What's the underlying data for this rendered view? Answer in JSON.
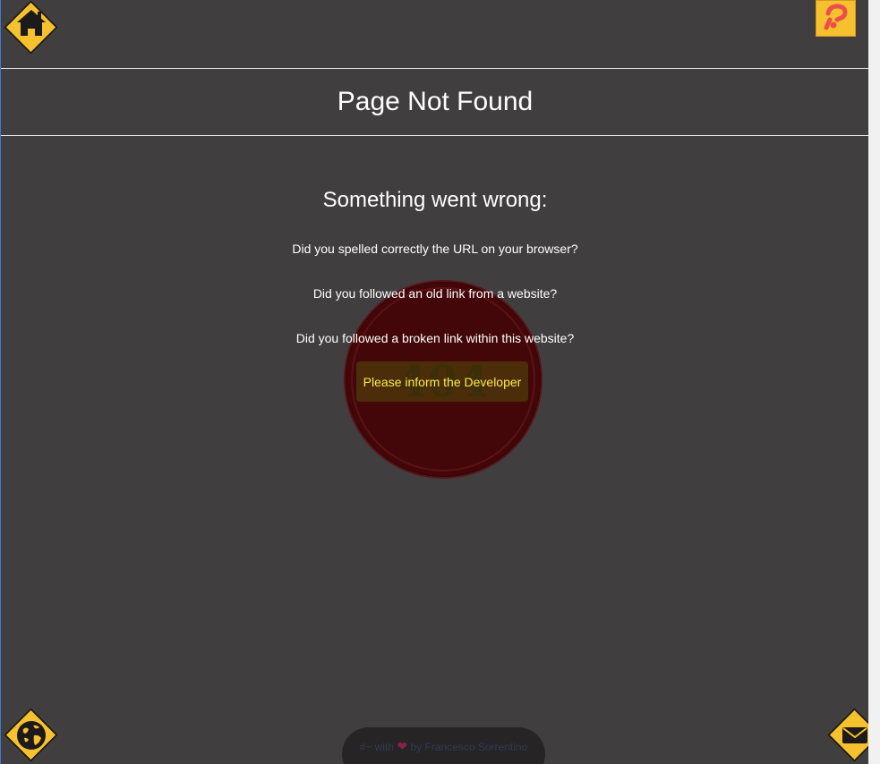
{
  "header": {
    "title": "Page Not Found"
  },
  "badge": {
    "code": "404"
  },
  "main": {
    "subtitle": "Something went wrong:",
    "questions": [
      "Did you spelled correctly the URL on your browser?",
      "Did you followed an old link from a website?",
      "Did you followed a broken link within this website?"
    ],
    "inform_label": "Please inform the Developer"
  },
  "footer": {
    "prefix": "#~ with",
    "suffix": "by Francesco Sorrentino"
  },
  "icons": {
    "home": "home-icon",
    "help": "help-icon",
    "globe": "globe-icon",
    "mail": "mail-icon"
  },
  "colors": {
    "background": "#403e3f",
    "accent": "#f6c12f",
    "badge": "#430709",
    "button_text": "#ffe94a"
  }
}
